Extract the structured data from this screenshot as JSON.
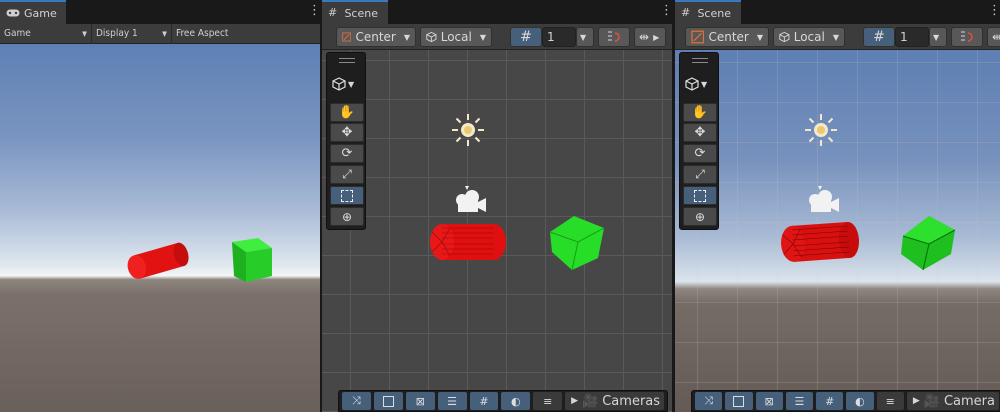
{
  "game_panel": {
    "tab_label": "Game",
    "toolbar": {
      "mode_dropdown": "Game",
      "display_dropdown": "Display 1",
      "aspect_dropdown": "Free Aspect"
    }
  },
  "scene_panels": [
    {
      "tab_label": "Scene",
      "pivot_dropdown": "Center",
      "space_dropdown": "Local",
      "grid_snap_value": "1",
      "cameras_label": "Cameras",
      "view": "orthographic top-down grid"
    },
    {
      "tab_label": "Scene",
      "pivot_dropdown": "Center",
      "space_dropdown": "Local",
      "grid_snap_value": "1",
      "cameras_label": "Camera",
      "view": "perspective with skybox"
    }
  ],
  "tools": [
    "hand-tool-icon",
    "move-tool-icon",
    "rotate-tool-icon",
    "scale-tool-icon",
    "rect-tool-icon",
    "transform-tool-icon"
  ],
  "active_tool": "rect-tool-icon",
  "overlay_buttons": [
    "snap-icon",
    "rect-overlay-icon",
    "navigation-icon",
    "lighting-icon",
    "grid-overlay-icon",
    "sphere-icon"
  ],
  "colors": {
    "cylinder": "#e01010",
    "cube": "#22dd22",
    "accent_blue": "#46607c",
    "tab_highlight": "#3a79bb"
  }
}
